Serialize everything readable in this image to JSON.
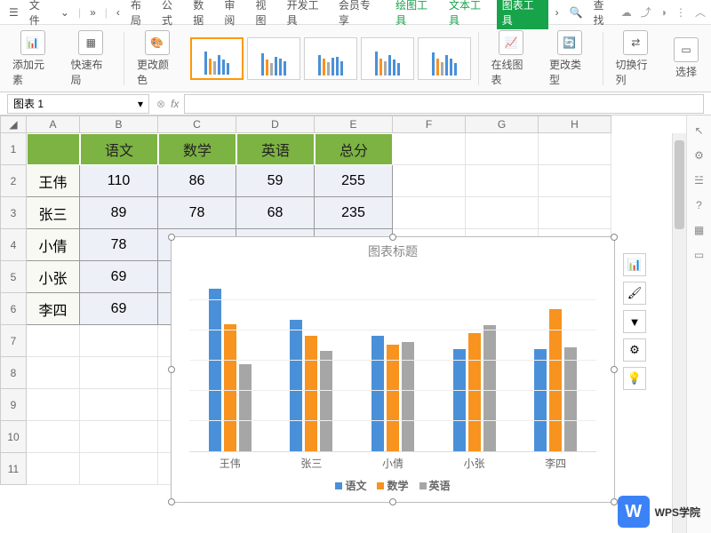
{
  "menu": {
    "file": "文件",
    "tabs": [
      "布局",
      "公式",
      "数据",
      "审阅",
      "视图",
      "开发工具",
      "会员专享"
    ],
    "tool_tabs": [
      "绘图工具",
      "文本工具",
      "图表工具"
    ],
    "search": "查找"
  },
  "ribbon": {
    "add_element": "添加元素",
    "quick_layout": "快速布局",
    "change_color": "更改颜色",
    "online_chart": "在线图表",
    "change_type": "更改类型",
    "switch_rowcol": "切换行列",
    "select": "选择"
  },
  "namebox": "图表 1",
  "headers": [
    "",
    "语文",
    "数学",
    "英语",
    "总分"
  ],
  "rows": [
    {
      "name": "王伟",
      "vals": [
        110,
        86,
        59,
        255
      ]
    },
    {
      "name": "张三",
      "vals": [
        89,
        78,
        68,
        235
      ]
    },
    {
      "name": "小倩",
      "vals": [
        78,
        "",
        "",
        ""
      ]
    },
    {
      "name": "小张",
      "vals": [
        69,
        "",
        "",
        ""
      ]
    },
    {
      "name": "李四",
      "vals": [
        69,
        "",
        "",
        ""
      ]
    }
  ],
  "chart_data": {
    "type": "bar",
    "title": "图表标题",
    "categories": [
      "王伟",
      "张三",
      "小倩",
      "小张",
      "李四"
    ],
    "series": [
      {
        "name": "语文",
        "values": [
          110,
          89,
          78,
          69,
          69
        ]
      },
      {
        "name": "数学",
        "values": [
          86,
          78,
          72,
          80,
          96
        ]
      },
      {
        "name": "英语",
        "values": [
          59,
          68,
          74,
          85,
          70
        ]
      }
    ],
    "ylim": [
      0,
      120
    ]
  },
  "watermark": "WPS学院",
  "col_letters": [
    "A",
    "B",
    "C",
    "D",
    "E",
    "F",
    "G",
    "H"
  ]
}
